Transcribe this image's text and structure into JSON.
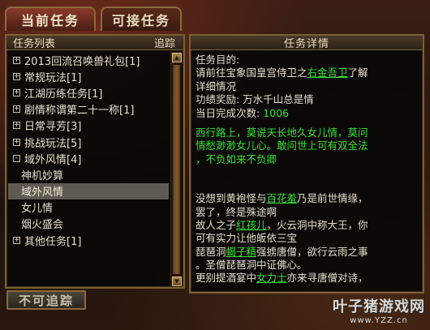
{
  "tabs": {
    "current": "当前任务",
    "available": "可接任务"
  },
  "left_panel": {
    "title": "任务列表",
    "track": "追踪"
  },
  "quest_list": [
    {
      "label": "2013回流召唤兽礼包[1]",
      "toggle": "+"
    },
    {
      "label": "常规玩法[1]",
      "toggle": "+"
    },
    {
      "label": "江湖历练任务[1]",
      "toggle": "+"
    },
    {
      "label": "剧情称谓第二十一称[1]",
      "toggle": "+"
    },
    {
      "label": "日常寻芳[3]",
      "toggle": "+"
    },
    {
      "label": "挑战玩法[5]",
      "toggle": "+"
    },
    {
      "label": "域外风情[4]",
      "toggle": "-"
    },
    {
      "label": "神机妙算",
      "child": true
    },
    {
      "label": "域外风情",
      "child": true,
      "selected": true
    },
    {
      "label": "女儿情",
      "child": true
    },
    {
      "label": "烟火盛会",
      "child": true
    },
    {
      "label": "其他任务[1]",
      "toggle": "+"
    }
  ],
  "right_panel": {
    "title": "任务详情",
    "goal_label": "任务目的:",
    "goal_pre": "请前往宝象国皇宫侍卫之",
    "goal_link": "右金吾卫",
    "goal_post": "了解",
    "goal_line2": "详细情况",
    "reward": "功绩奖励: 万水千山总是情",
    "done_label": "当日完成次数: ",
    "done_value": "1006",
    "poem1": "西行路上，莫说天长地久女儿情，莫问",
    "poem2": "情愁渺渺女儿心。敢问世上可有双全法",
    "poem3": "，不负如来不负卿",
    "story1_pre": "没想到黄袍怪与",
    "story1_link": "百花羞",
    "story1_post": "乃是前世情缘，",
    "story2": "罢了，终是殊途啊",
    "story3_pre": "故人之子",
    "story3_link": "红孩儿",
    "story3_post": "，火云洞中称大王，你",
    "story4": "可有实力让他皈依三宝",
    "story5_pre": "琵琶洞",
    "story5_link": "蝎子精",
    "story5_post": "强掳唐僧，欲行云雨之事",
    "story6": "。圣僧琵琶洞中证佛心。",
    "story7_pre": "更别提酒宴中",
    "story7_link": "女力士",
    "story7_post": "亦来寻唐僧对诗，"
  },
  "buttons": {
    "untrack": "不可追踪"
  },
  "watermark": {
    "title": "叶子猪游戏网",
    "url": "www.YZZ.cn"
  }
}
